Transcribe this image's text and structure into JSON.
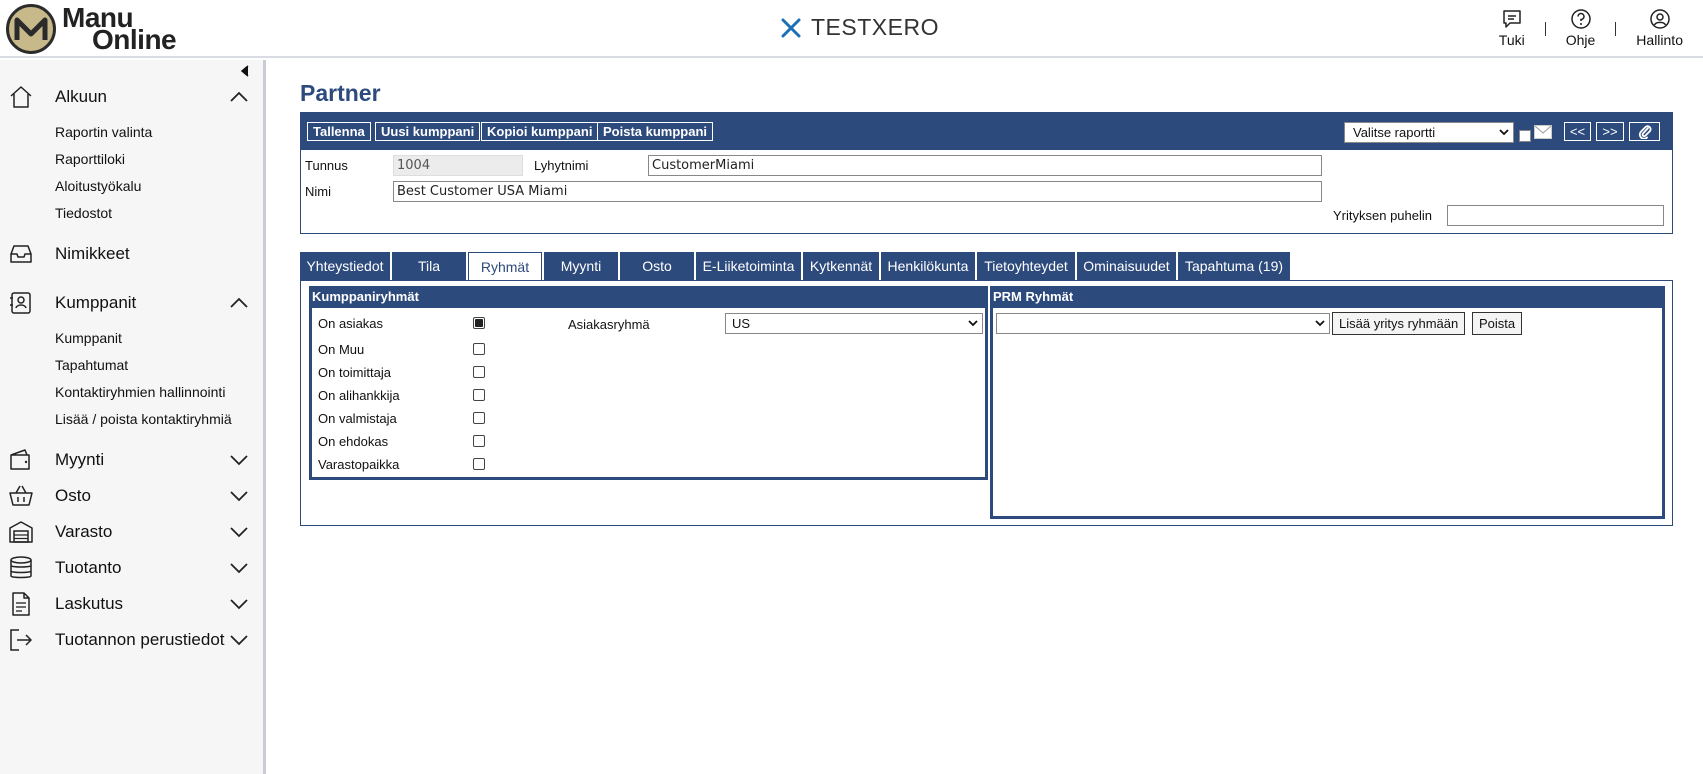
{
  "header": {
    "logo_line1": "Manu",
    "logo_line2": "Online",
    "brand": "TESTXERO",
    "nav": [
      {
        "label": "Tuki",
        "icon": "chat-icon"
      },
      {
        "label": "Ohje",
        "icon": "help-icon"
      },
      {
        "label": "Hallinto",
        "icon": "user-icon"
      }
    ]
  },
  "sidebar": {
    "sections": [
      {
        "label": "Alkuun",
        "icon": "home-icon",
        "expanded": true,
        "items": [
          "Raportin valinta",
          "Raporttiloki",
          "Aloitustyökalu",
          "Tiedostot"
        ]
      },
      {
        "label": "Nimikkeet",
        "icon": "inbox-icon"
      },
      {
        "label": "Kumppanit",
        "icon": "contact-card-icon",
        "expanded": true,
        "items": [
          "Kumppanit",
          "Tapahtumat",
          "Kontaktiryhmien hallinnointi",
          "Lisää / poista kontaktiryhmiä"
        ]
      },
      {
        "label": "Myynti",
        "icon": "wallet-icon"
      },
      {
        "label": "Osto",
        "icon": "basket-icon"
      },
      {
        "label": "Varasto",
        "icon": "warehouse-icon"
      },
      {
        "label": "Tuotanto",
        "icon": "database-icon"
      },
      {
        "label": "Laskutus",
        "icon": "document-icon"
      },
      {
        "label": "Tuotannon perustiedot",
        "icon": "logout-icon"
      }
    ]
  },
  "page": {
    "title": "Partner",
    "toolbar": {
      "buttons": [
        "Tallenna",
        "Uusi kumppani",
        "Kopioi kumppani",
        "Poista kumppani"
      ],
      "report_select": "Valitse raportti",
      "prev": "<<",
      "next": ">>"
    },
    "form": {
      "tunnus_label": "Tunnus",
      "tunnus_value": "1004",
      "lyhytnimi_label": "Lyhytnimi",
      "lyhytnimi_value": "CustomerMiami",
      "nimi_label": "Nimi",
      "nimi_value": "Best Customer USA Miami",
      "puhelin_label": "Yrityksen puhelin",
      "puhelin_value": ""
    },
    "tabs": [
      "Yhteystiedot",
      "Tila",
      "Ryhmät",
      "Myynti",
      "Osto",
      "E-Liiketoiminta",
      "Kytkennät",
      "Henkilökunta",
      "Tietoyhteydet",
      "Ominaisuudet",
      "Tapahtuma (19)"
    ],
    "active_tab": "Ryhmät",
    "kumppaniryhmat": {
      "title": "Kumppaniryhmät",
      "rows": [
        {
          "label": "On asiakas",
          "checked": true
        },
        {
          "label": "On Muu",
          "checked": false
        },
        {
          "label": "On toimittaja",
          "checked": false
        },
        {
          "label": "On alihankkija",
          "checked": false
        },
        {
          "label": "On valmistaja",
          "checked": false
        },
        {
          "label": "On ehdokas",
          "checked": false
        },
        {
          "label": "Varastopaikka",
          "checked": false
        }
      ],
      "asiakasryhma_label": "Asiakasryhmä",
      "asiakasryhma_value": "US"
    },
    "prm": {
      "title": "PRM Ryhmät",
      "select_value": "",
      "add_button": "Lisää yritys ryhmään",
      "remove_button": "Poista"
    }
  },
  "colors": {
    "primary": "#2d4a7c",
    "brand_icon": "#1a6fb8",
    "logo_gold": "#c7b98a"
  }
}
